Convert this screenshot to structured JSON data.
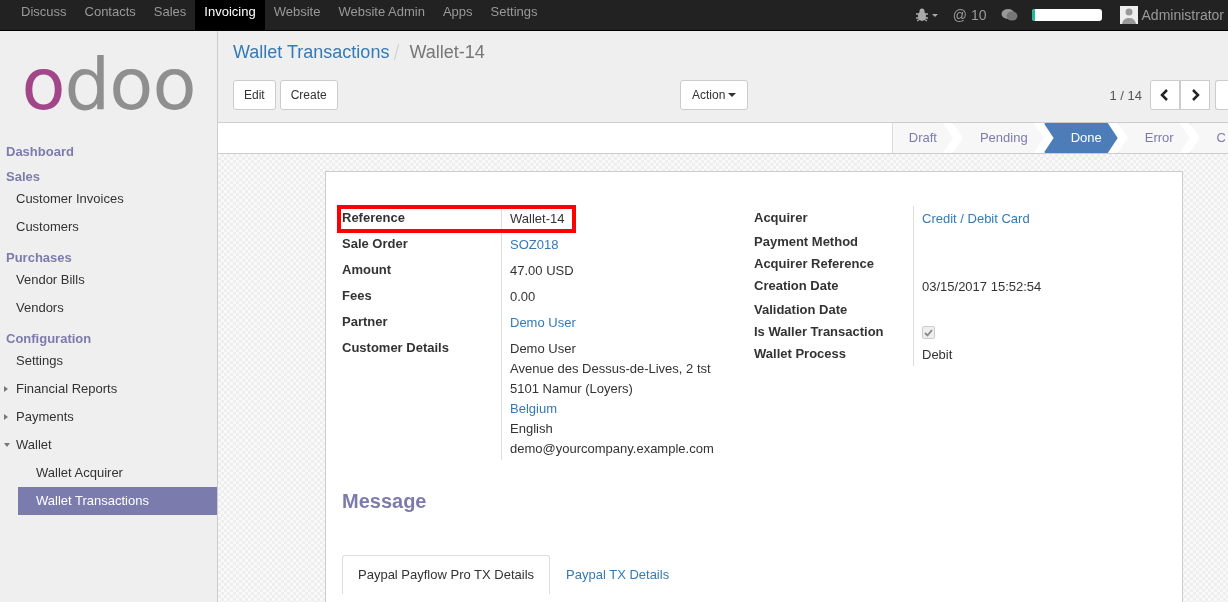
{
  "top_menu": [
    {
      "label": "Discuss",
      "selected": false
    },
    {
      "label": "Contacts",
      "selected": false
    },
    {
      "label": "Sales",
      "selected": false
    },
    {
      "label": "Invoicing",
      "selected": true
    },
    {
      "label": "Website",
      "selected": false
    },
    {
      "label": "Website Admin",
      "selected": false
    },
    {
      "label": "Apps",
      "selected": false
    },
    {
      "label": "Settings",
      "selected": false
    }
  ],
  "systray": {
    "mentions": "@ 10",
    "progress": {
      "level": 0.05
    },
    "user": "Administrator"
  },
  "logo": "odoo",
  "sidebar": [
    {
      "title": "Dashboard"
    },
    {
      "title": "Sales",
      "items": [
        {
          "label": "Customer Invoices",
          "selected": false
        },
        {
          "label": "Customers",
          "selected": false
        }
      ]
    },
    {
      "title": "Purchases",
      "items": [
        {
          "label": "Vendor Bills",
          "selected": false
        },
        {
          "label": "Vendors",
          "selected": false
        }
      ]
    },
    {
      "title": "Configuration",
      "items": [
        {
          "label": "Settings",
          "selected": false
        },
        {
          "label": "Financial Reports",
          "selected": false,
          "expanded": false
        },
        {
          "label": "Payments",
          "selected": false,
          "expanded": false
        },
        {
          "label": "Wallet",
          "selected": false,
          "expanded": true,
          "children": [
            {
              "label": "Wallet Acquirer",
              "selected": false
            },
            {
              "label": "Wallet Transactions",
              "selected": true
            }
          ]
        }
      ]
    }
  ],
  "breadcrumb": {
    "parent": "Wallet Transactions",
    "current": "Wallet-14"
  },
  "buttons": [
    "Edit",
    "Create"
  ],
  "action_button": "Action",
  "pager": "1 / 14",
  "stages": [
    {
      "label": "Draft",
      "selected": false
    },
    {
      "label": "Pending",
      "selected": false
    },
    {
      "label": "Done",
      "selected": true
    },
    {
      "label": "Error",
      "selected": false
    },
    {
      "label": "C",
      "selected": false
    }
  ],
  "left_fields": [
    {
      "label": "Reference",
      "highlighted": true,
      "values": [
        {
          "text": "Wallet-14",
          "link": false
        }
      ]
    },
    {
      "label": "Sale Order",
      "highlighted": false,
      "values": [
        {
          "text": "SOZ018",
          "link": true
        }
      ]
    },
    {
      "label": "Amount",
      "highlighted": false,
      "values": [
        {
          "text": "47.00 USD",
          "link": false
        }
      ]
    },
    {
      "label": "Fees",
      "highlighted": false,
      "values": [
        {
          "text": "0.00",
          "link": false
        }
      ]
    },
    {
      "label": "Partner",
      "highlighted": false,
      "values": [
        {
          "text": "Demo User",
          "link": true
        }
      ]
    },
    {
      "label": "Customer Details",
      "highlighted": false,
      "values": [
        {
          "text": "Demo User",
          "link": false
        },
        {
          "text": "Avenue des Dessus-de-Lives, 2 tst",
          "link": false
        },
        {
          "text": "5101 Namur (Loyers)",
          "link": false
        },
        {
          "text": "Belgium",
          "link": true
        },
        {
          "text": "English",
          "link": false
        },
        {
          "text": "demo@yourcompany.example.com",
          "link": false
        }
      ]
    }
  ],
  "right_fields": [
    {
      "label": "Acquirer",
      "kind": "text",
      "values": [
        {
          "text": "Credit / Debit Card",
          "link": true
        }
      ]
    },
    {
      "label": "Payment Method",
      "kind": "text"
    },
    {
      "label": "Acquirer Reference",
      "kind": "text"
    },
    {
      "label": "Creation Date",
      "kind": "text",
      "values": [
        {
          "text": "03/15/2017 15:52:54",
          "link": false
        }
      ]
    },
    {
      "label": "Validation Date",
      "kind": "text"
    },
    {
      "label": "Is Waller Transaction",
      "kind": "checkbox",
      "checked": true
    },
    {
      "label": "Wallet Process",
      "kind": "text",
      "values": [
        {
          "text": "Debit",
          "link": false
        }
      ]
    }
  ],
  "message_heading": "Message",
  "notebook_tabs": [
    {
      "label": "Paypal Payflow Pro TX Details",
      "selected": true
    },
    {
      "label": "Paypal TX Details",
      "selected": false
    }
  ]
}
